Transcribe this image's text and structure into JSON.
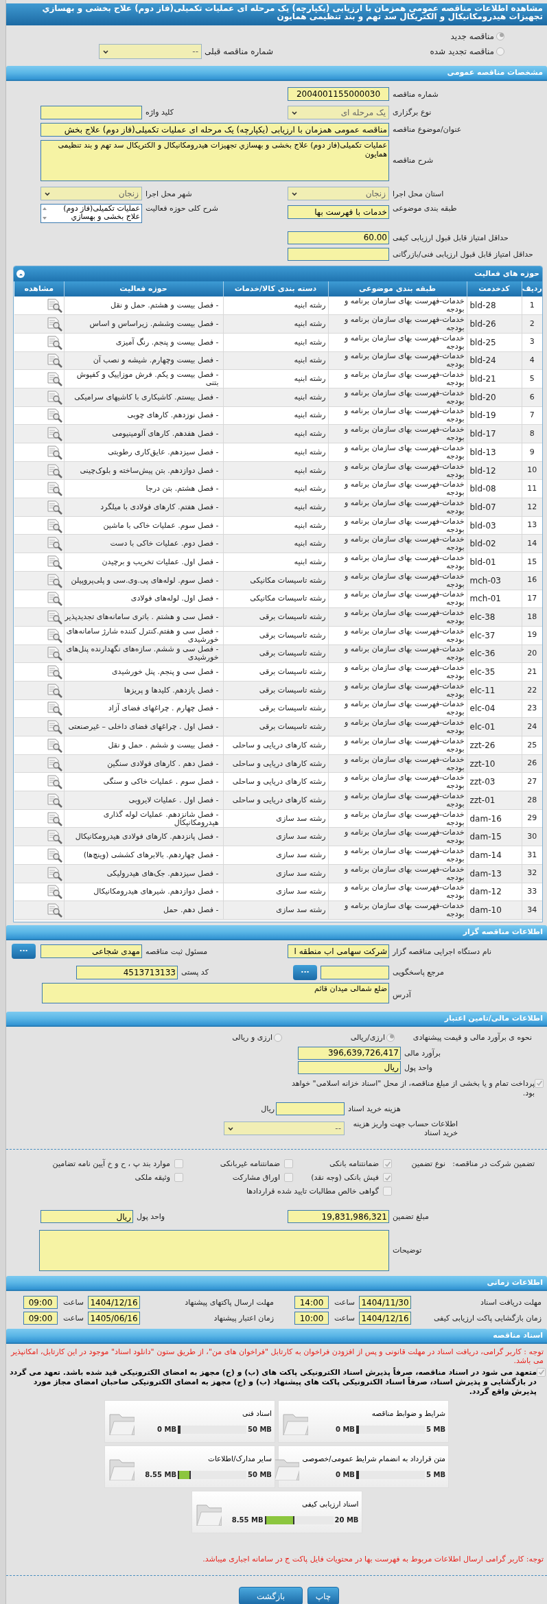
{
  "title": "مشاهده اطلاعات مناقصه عمومی همزمان با ارزیابی (یکپارچه) یک مرحله ای عملیات تکمیلی(فاز دوم) علاج بخشی و بهسازي تجهیزات هیدرومکانیکال و الکتریکال سد تهم و بند تنظیمی همایون",
  "tender_status": [
    {
      "label": "مناقصه جدید",
      "selected": true
    },
    {
      "label": "مناقصه تجدید شده",
      "selected": false
    }
  ],
  "previous_tender": {
    "label": "شماره مناقصه قبلی",
    "value": "--"
  },
  "general": {
    "header": "مشخصات مناقصه عمومی",
    "tender_number": {
      "label": "شماره مناقصه",
      "value": "2004001155000030"
    },
    "holding_type": {
      "label": "نوع برگزاری",
      "value": "یک مرحله ای"
    },
    "keyword": {
      "label": "کلید واژه"
    },
    "subject": {
      "label": "عنوان/موضوع مناقصه",
      "value": "مناقصه عمومی همزمان با ارزیابی (یکپارچه) یک مرحله ای عملیات تکمیلی(فاز دوم) علاج بخش"
    },
    "description": {
      "label": "شرح مناقصه",
      "value": "عملیات تکمیلی(فاز دوم) علاج بخشی و بهسازي تجهیزات هیدرومکانیکال و الکتریکال سد تهم و بند تنظیمی همایون"
    },
    "province": {
      "label": "استان محل اجرا",
      "value": "زنجان"
    },
    "city": {
      "label": "شهر محل اجرا",
      "value": "زنجان"
    },
    "category": {
      "label": "طبقه بندی موضوعی",
      "value": "خدمات با فهرست بها"
    },
    "activity_summary": {
      "label": "شرح کلی حوزه فعالیت",
      "value": "عملیات تکمیلی(فاز دوم) علاج بخشی و بهسازي"
    },
    "min_quality_score": {
      "label": "حداقل امتیاز قابل قبول ارزیابی کیفی",
      "value": "60.00"
    },
    "min_technical_score": {
      "label": "حداقل امتیاز قابل قبول ارزیابی فنی/بازرگانی"
    }
  },
  "activities": {
    "header": "حوزه های فعالیت",
    "columns": [
      "ردیف",
      "کدخدمت",
      "طبقه بندی موضوعی",
      "دسته بندی کالا/خدمات",
      "حوزه فعالیت",
      "مشاهده"
    ],
    "rows": [
      {
        "row": "1",
        "code": "bld-28",
        "category": "خدمات-فهرست بهای سازمان برنامه و بودجه",
        "group": "رشته ابنیه",
        "activity": "- فصل بیست و هشتم. حمل و نقل"
      },
      {
        "row": "2",
        "code": "bld-26",
        "category": "خدمات-فهرست بهای سازمان برنامه و بودجه",
        "group": "رشته ابنیه",
        "activity": "- فصل بیست وششم. زیراساس و اساس"
      },
      {
        "row": "3",
        "code": "bld-25",
        "category": "خدمات-فهرست بهای سازمان برنامه و بودجه",
        "group": "رشته ابنیه",
        "activity": "- فصل بیست و پنجم. رنگ آمیزی"
      },
      {
        "row": "4",
        "code": "bld-24",
        "category": "خدمات-فهرست بهای سازمان برنامه و بودجه",
        "group": "رشته ابنیه",
        "activity": "- فصل بیست وچهارم. شیشه و نصب آن"
      },
      {
        "row": "5",
        "code": "bld-21",
        "category": "خدمات-فهرست بهای سازمان برنامه و بودجه",
        "group": "رشته ابنیه",
        "activity": "- فصل بیست و یکم. فرش موزاییک و کفپوش بتنی"
      },
      {
        "row": "6",
        "code": "bld-20",
        "category": "خدمات-فهرست بهای سازمان برنامه و بودجه",
        "group": "رشته ابنیه",
        "activity": "- فصل بیستم. کاشیکاری با کاشیهای سرامیکی"
      },
      {
        "row": "7",
        "code": "bld-19",
        "category": "خدمات-فهرست بهای سازمان برنامه و بودجه",
        "group": "رشته ابنیه",
        "activity": "- فصل نوزدهم. کارهای چوبی"
      },
      {
        "row": "8",
        "code": "bld-17",
        "category": "خدمات-فهرست بهای سازمان برنامه و بودجه",
        "group": "رشته ابنیه",
        "activity": "- فصل هفدهم. کارهای آلومینیومی"
      },
      {
        "row": "9",
        "code": "bld-13",
        "category": "خدمات-فهرست بهای سازمان برنامه و بودجه",
        "group": "رشته ابنیه",
        "activity": "- فصل سیزدهم. عایق‌کاری رطوبتی"
      },
      {
        "row": "10",
        "code": "bld-12",
        "category": "خدمات-فهرست بهای سازمان برنامه و بودجه",
        "group": "رشته ابنیه",
        "activity": "- فصل دوازدهم. بتن پیش‌ساخته و بلوک‌چینی"
      },
      {
        "row": "11",
        "code": "bld-08",
        "category": "خدمات-فهرست بهای سازمان برنامه و بودجه",
        "group": "رشته ابنیه",
        "activity": "- فصل هشتم. بتن درجا"
      },
      {
        "row": "12",
        "code": "bld-07",
        "category": "خدمات-فهرست بهای سازمان برنامه و بودجه",
        "group": "رشته ابنیه",
        "activity": "- فصل هفتم. کارهای فولادی با میلگرد"
      },
      {
        "row": "13",
        "code": "bld-03",
        "category": "خدمات-فهرست بهای سازمان برنامه و بودجه",
        "group": "رشته ابنیه",
        "activity": "- فصل سوم. عملیات خاکی با ماشین"
      },
      {
        "row": "14",
        "code": "bld-02",
        "category": "خدمات-فهرست بهای سازمان برنامه و بودجه",
        "group": "رشته ابنیه",
        "activity": "- فصل دوم. عملیات خاکی با دست"
      },
      {
        "row": "15",
        "code": "bld-01",
        "category": "خدمات-فهرست بهای سازمان برنامه و بودجه",
        "group": "رشته ابنیه",
        "activity": "- فصل اول. عملیات تخریب و برچیدن"
      },
      {
        "row": "16",
        "code": "mch-03",
        "category": "خدمات-فهرست بهای سازمان برنامه و بودجه",
        "group": "رشته تاسیسات مکانیکی",
        "activity": "- فصل سوم. لوله‌های پی.وی.سی و پلی‌پروپیلن"
      },
      {
        "row": "17",
        "code": "mch-01",
        "category": "خدمات-فهرست بهای سازمان برنامه و بودجه",
        "group": "رشته تاسیسات مکانیکی",
        "activity": "- فصل اول. لوله‌های فولادی"
      },
      {
        "row": "18",
        "code": "elc-38",
        "category": "خدمات-فهرست بهای سازمان برنامه و بودجه",
        "group": "رشته تاسیسات برقی",
        "activity": "- فصل سی و هشتم . باتری سامانه‌های تجدیدپذیر"
      },
      {
        "row": "19",
        "code": "elc-37",
        "category": "خدمات-فهرست بهای سازمان برنامه و بودجه",
        "group": "رشته تاسیسات برقی",
        "activity": "- فصل سی و هفتم.کنترل کننده شارژ سامانه‌های خورشیدی"
      },
      {
        "row": "20",
        "code": "elc-36",
        "category": "خدمات-فهرست بهای سازمان برنامه و بودجه",
        "group": "رشته تاسیسات برقی",
        "activity": "- فصل سی و ششم. سازه‌های نگهدارنده پنل‌های خورشیدی"
      },
      {
        "row": "21",
        "code": "elc-35",
        "category": "خدمات-فهرست بهای سازمان برنامه و بودجه",
        "group": "رشته تاسیسات برقی",
        "activity": "- فصل سی و پنجم. پنل خورشیدی"
      },
      {
        "row": "22",
        "code": "elc-11",
        "category": "خدمات-فهرست بهای سازمان برنامه و بودجه",
        "group": "رشته تاسیسات برقی",
        "activity": "- فصل یازدهم. کلیدها و پریزها"
      },
      {
        "row": "23",
        "code": "elc-04",
        "category": "خدمات-فهرست بهای سازمان برنامه و بودجه",
        "group": "رشته تاسیسات برقی",
        "activity": "- فصل چهارم . چراغهای فضای آزاد"
      },
      {
        "row": "24",
        "code": "elc-01",
        "category": "خدمات-فهرست بهای سازمان برنامه و بودجه",
        "group": "رشته تاسیسات برقی",
        "activity": "- فصل اول . چراغهای فضای داخلی – غیرصنعتی"
      },
      {
        "row": "25",
        "code": "zzt-26",
        "category": "خدمات-فهرست بهای سازمان برنامه و بودجه",
        "group": "رشته کارهای دریایی و ساحلی",
        "activity": "- فصل بیست و ششم . حمل و نقل"
      },
      {
        "row": "26",
        "code": "zzt-10",
        "category": "خدمات-فهرست بهای سازمان برنامه و بودجه",
        "group": "رشته کارهای دریایی و ساحلی",
        "activity": "- فصل دهم . کارهای فولادی سنگین"
      },
      {
        "row": "27",
        "code": "zzt-03",
        "category": "خدمات-فهرست بهای سازمان برنامه و بودجه",
        "group": "رشته کارهای دریایی و ساحلی",
        "activity": "- فصل سوم . عملیات خاکی و سنگی"
      },
      {
        "row": "28",
        "code": "zzt-01",
        "category": "خدمات-فهرست بهای سازمان برنامه و بودجه",
        "group": "رشته کارهای دریایی و ساحلی",
        "activity": "- فصل اول . عملیات لایروبی"
      },
      {
        "row": "29",
        "code": "dam-16",
        "category": "خدمات-فهرست بهای سازمان برنامه و بودجه",
        "group": "رشته سد سازی",
        "activity": "- فصل شانزدهم. عملیات لوله گذاری هیدرومکانیکال"
      },
      {
        "row": "30",
        "code": "dam-15",
        "category": "خدمات-فهرست بهای سازمان برنامه و بودجه",
        "group": "رشته سد سازی",
        "activity": "- فصل پانزدهم. کارهای فولادی هیدرومکانیکال"
      },
      {
        "row": "31",
        "code": "dam-14",
        "category": "خدمات-فهرست بهای سازمان برنامه و بودجه",
        "group": "رشته سد سازی",
        "activity": "- فصل چهاردهم. بالابرهای کششی (وینچ‌ها)"
      },
      {
        "row": "32",
        "code": "dam-13",
        "category": "خدمات-فهرست بهای سازمان برنامه و بودجه",
        "group": "رشته سد سازی",
        "activity": "- فصل سیزدهم. جک‌های هیدرولیکی"
      },
      {
        "row": "33",
        "code": "dam-12",
        "category": "خدمات-فهرست بهای سازمان برنامه و بودجه",
        "group": "رشته سد سازی",
        "activity": "- فصل دوازدهم. شیرهای هیدرومکانیکال"
      },
      {
        "row": "34",
        "code": "dam-10",
        "category": "خدمات-فهرست بهای سازمان برنامه و بودجه",
        "group": "رشته سد سازی",
        "activity": "- فصل دهم. حمل"
      }
    ]
  },
  "employer": {
    "header": "اطلاعات مناقصه گزار",
    "organization": {
      "label": "نام دستگاه اجرایی مناقصه گزار",
      "value": "شرکت سهامی اب منطقه ا"
    },
    "registrar": {
      "label": "مسئول ثبت مناقصه",
      "value": "مهدی شجاعی",
      "button": "..."
    },
    "contact_reference": {
      "label": "مرجع پاسخگویی",
      "button": "..."
    },
    "postal_code": {
      "label": "کد پستی",
      "value": "4513713133"
    },
    "address": {
      "label": "آدرس",
      "value": "ضلع شمالی میدان قائم"
    }
  },
  "financial": {
    "header": "اطلاعات مالی/تامین اعتبار",
    "estimate_method": {
      "label": "نحوه ی برآورد مالی و قیمت پیشنهادی",
      "options": [
        {
          "label": "ارزی/ریالی",
          "selected": true
        },
        {
          "label": "ارزی و ریالی",
          "selected": false
        }
      ]
    },
    "estimate": {
      "label": "برآورد مالی",
      "value": "396,639,726,417"
    },
    "currency": {
      "label": "واحد پول",
      "value": "ریال"
    },
    "treasury": {
      "label": "پرداخت تمام و یا بخشی از مبلغ مناقصه، از محل \"اسناد خزانه اسلامی\" خواهد بود.",
      "checked": true
    },
    "document_fee": {
      "label": "هزینه خرید اسناد",
      "unit": "ریال"
    },
    "account": {
      "label": "اطلاعات حساب جهت واریز هزینه خرید اسناد",
      "value": "--"
    }
  },
  "guarantee": {
    "label": "تضمین شرکت در مناقصه:",
    "type_label": "نوع تضمین",
    "options": [
      {
        "label": "ضمانتنامه بانکی",
        "checked": true
      },
      {
        "label": "ضمانتنامه غیربانکی",
        "checked": false
      },
      {
        "label": "موارد بند پ ، ح و خ آیین نامه تضامین",
        "checked": false
      },
      {
        "label": "فیش بانکی (وجه نقد)",
        "checked": true
      },
      {
        "label": "اوراق مشارکت",
        "checked": false
      },
      {
        "label": "وثیقه ملکی",
        "checked": false
      },
      {
        "label": "گواهی خالص مطالبات تایید شده قراردادها",
        "checked": false
      }
    ],
    "amount": {
      "label": "مبلغ تضمین",
      "value": "19,831,986,321"
    },
    "currency": {
      "label": "واحد پول",
      "value": "ریال"
    },
    "notes": {
      "label": "توضیحات"
    }
  },
  "timing": {
    "header": "اطلاعات زمانی",
    "items": [
      {
        "label": "مهلت دریافت اسناد",
        "date": "1404/11/30",
        "time_label": "ساعت",
        "time": "14:00"
      },
      {
        "label": "مهلت ارسال پاکتهای پیشنهاد",
        "date": "1404/12/16",
        "time_label": "ساعت",
        "time": "09:00"
      },
      {
        "label": "زمان بازگشایی پاکت ارزیابی کیفی",
        "date": "1404/12/16",
        "time_label": "ساعت",
        "time": "10:00"
      },
      {
        "label": "زمان اعتبار پیشنهاد",
        "date": "1405/06/16",
        "time_label": "ساعت",
        "time": "09:00"
      }
    ]
  },
  "documents": {
    "header": "اسناد مناقصه",
    "notice": "توجه : کاربر گرامی، دریافت اسناد در مهلت قانونی و پس از افزودن فراخوان به کارتابل \"فراخوان های من\"، از طریق ستون \"دانلود اسناد\" موجود در این کارتابل، امکانپذیر می باشد.",
    "commitment": {
      "text": "متعهد می شود در اسناد مناقصه، صرفاً پذیرش اسناد الکترونیکی پاکت های (ب) و (ج) مجهز به امضای الکترونیکی قید شده باشد. تعهد می گردد در بازگشایی و پذیرش اسناد، صرفاً اسناد الکترونیکی پاکت های پیشنهاد (ب) و (ج) مجهز به امضای الکترونیکی صاحبان امضای مجاز مورد پذیرش واقع گردد.",
      "checked": true
    },
    "files": [
      {
        "title": "شرایط و ضوابط مناقصه",
        "limit": "5 MB",
        "used": "0 MB",
        "level": 0
      },
      {
        "title": "اسناد فنی",
        "limit": "50 MB",
        "used": "0 MB",
        "level": 0
      },
      {
        "title": "متن قرارداد به انضمام شرایط عمومی/خصوصی",
        "limit": "5 MB",
        "used": "0 MB",
        "level": 0
      },
      {
        "title": "سایر مدارک/اطلاعات",
        "limit": "50 MB",
        "used": "8.55 MB",
        "level": 0.171
      },
      {
        "title": "اسناد ارزیابی کیفی",
        "limit": "20 MB",
        "used": "8.55 MB",
        "level": 0.4275
      }
    ],
    "footer_notice": "توجه: کاربر گرامی ارسال اطلاعات مربوط به فهرست بها در محتویات فایل پاکت ج در سامانه اجباری میباشد."
  },
  "buttons": [
    "چاپ",
    "بازگشت"
  ]
}
